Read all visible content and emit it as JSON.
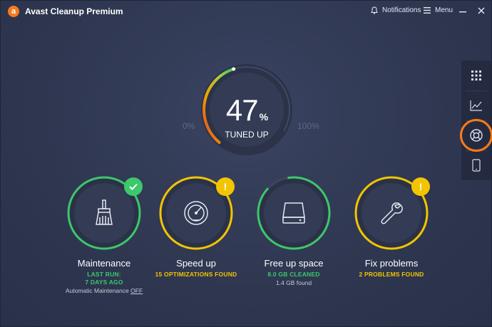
{
  "app": {
    "title": "Avast Cleanup Premium",
    "logo_letter": "a",
    "brand_color": "#f47a20"
  },
  "header": {
    "notifications_label": "Notifications",
    "menu_label": "Menu",
    "icons": [
      "bell-icon",
      "hamburger-icon",
      "minimize-icon",
      "close-icon"
    ]
  },
  "gauge": {
    "value": "47",
    "unit": "%",
    "caption": "TUNED UP",
    "min_label": "0%",
    "max_label": "100%",
    "fraction": 0.47
  },
  "right_toolbar": {
    "items": [
      {
        "name": "dashboard",
        "icon": "grid-icon"
      },
      {
        "name": "performance",
        "icon": "chart-icon"
      },
      {
        "name": "help",
        "icon": "lifebuoy-icon",
        "highlighted": true
      },
      {
        "name": "mobile",
        "icon": "phone-icon"
      }
    ]
  },
  "cards": [
    {
      "title": "Maintenance",
      "status": "LAST RUN:",
      "status2": "7 DAYS AGO",
      "sub_prefix": "Automatic Maintenance",
      "sub_link": "OFF",
      "ring_color": "#3cc86b",
      "badge": "check",
      "icon": "broom-icon"
    },
    {
      "title": "Speed up",
      "status": "15 OPTIMIZATIONS FOUND",
      "ring_color": "#f2c500",
      "badge": "!",
      "icon": "speedometer-icon"
    },
    {
      "title": "Free up space",
      "status": "8.0 GB CLEANED",
      "sub": "1.4 GB found",
      "ring_color": "#3cc86b",
      "ring_fraction": 0.9,
      "icon": "hard-drive-icon"
    },
    {
      "title": "Fix problems",
      "status": "2 PROBLEMS FOUND",
      "ring_color": "#f2c500",
      "badge": "!",
      "icon": "wrench-icon"
    }
  ],
  "colors": {
    "background": "#2e3650",
    "green": "#3cc86b",
    "yellow": "#f2c500",
    "highlight": "#ff7a1a"
  }
}
